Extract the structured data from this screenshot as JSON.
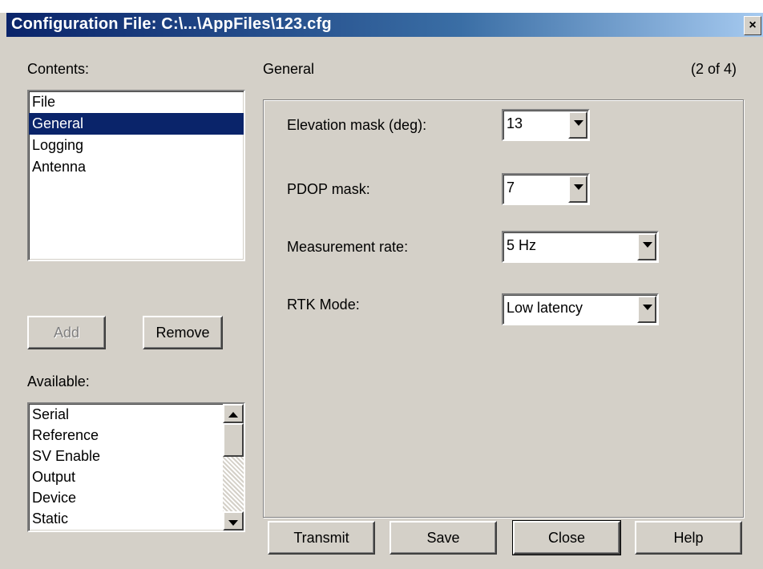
{
  "window": {
    "title": "Configuration File: C:\\...\\AppFiles\\123.cfg",
    "close_label": "×"
  },
  "contents": {
    "label": "Contents:",
    "items": [
      {
        "label": "File",
        "selected": false
      },
      {
        "label": "General",
        "selected": true
      },
      {
        "label": "Logging",
        "selected": false
      },
      {
        "label": "Antenna",
        "selected": false
      }
    ]
  },
  "buttons": {
    "add": "Add",
    "remove": "Remove",
    "transmit": "Transmit",
    "save": "Save",
    "close": "Close",
    "help": "Help"
  },
  "available": {
    "label": "Available:",
    "items": [
      "Serial",
      "Reference",
      "SV Enable",
      "Output",
      "Device",
      "Static"
    ]
  },
  "section": {
    "title": "General",
    "page_indicator": "(2 of 4)"
  },
  "settings": {
    "elevation_mask": {
      "label": "Elevation mask (deg):",
      "value": "13"
    },
    "pdop_mask": {
      "label": "PDOP mask:",
      "value": "7"
    },
    "measurement_rate": {
      "label": "Measurement rate:",
      "value": "5 Hz"
    },
    "rtk_mode": {
      "label": "RTK Mode:",
      "value": "Low latency"
    }
  },
  "colors": {
    "selection": "#0a246a",
    "dialog_face": "#d4d0c8"
  }
}
